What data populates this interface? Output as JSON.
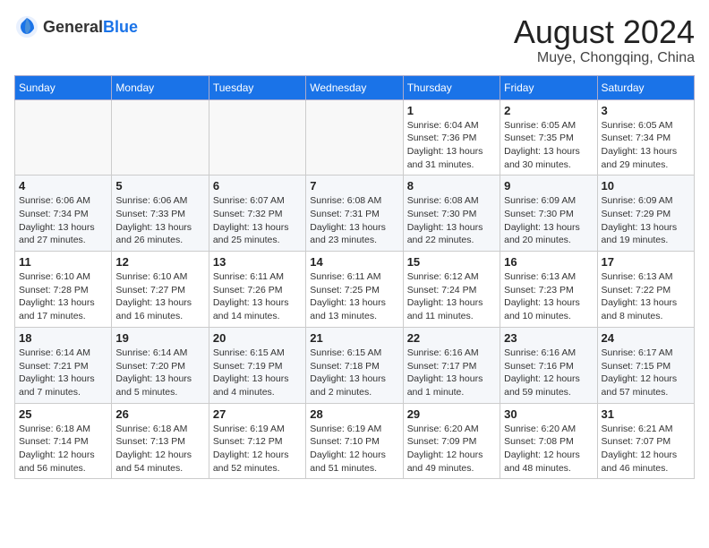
{
  "header": {
    "logo_general": "General",
    "logo_blue": "Blue",
    "month_title": "August 2024",
    "location": "Muye, Chongqing, China"
  },
  "weekdays": [
    "Sunday",
    "Monday",
    "Tuesday",
    "Wednesday",
    "Thursday",
    "Friday",
    "Saturday"
  ],
  "weeks": [
    [
      {
        "day": "",
        "info": ""
      },
      {
        "day": "",
        "info": ""
      },
      {
        "day": "",
        "info": ""
      },
      {
        "day": "",
        "info": ""
      },
      {
        "day": "1",
        "info": "Sunrise: 6:04 AM\nSunset: 7:36 PM\nDaylight: 13 hours\nand 31 minutes."
      },
      {
        "day": "2",
        "info": "Sunrise: 6:05 AM\nSunset: 7:35 PM\nDaylight: 13 hours\nand 30 minutes."
      },
      {
        "day": "3",
        "info": "Sunrise: 6:05 AM\nSunset: 7:34 PM\nDaylight: 13 hours\nand 29 minutes."
      }
    ],
    [
      {
        "day": "4",
        "info": "Sunrise: 6:06 AM\nSunset: 7:34 PM\nDaylight: 13 hours\nand 27 minutes."
      },
      {
        "day": "5",
        "info": "Sunrise: 6:06 AM\nSunset: 7:33 PM\nDaylight: 13 hours\nand 26 minutes."
      },
      {
        "day": "6",
        "info": "Sunrise: 6:07 AM\nSunset: 7:32 PM\nDaylight: 13 hours\nand 25 minutes."
      },
      {
        "day": "7",
        "info": "Sunrise: 6:08 AM\nSunset: 7:31 PM\nDaylight: 13 hours\nand 23 minutes."
      },
      {
        "day": "8",
        "info": "Sunrise: 6:08 AM\nSunset: 7:30 PM\nDaylight: 13 hours\nand 22 minutes."
      },
      {
        "day": "9",
        "info": "Sunrise: 6:09 AM\nSunset: 7:30 PM\nDaylight: 13 hours\nand 20 minutes."
      },
      {
        "day": "10",
        "info": "Sunrise: 6:09 AM\nSunset: 7:29 PM\nDaylight: 13 hours\nand 19 minutes."
      }
    ],
    [
      {
        "day": "11",
        "info": "Sunrise: 6:10 AM\nSunset: 7:28 PM\nDaylight: 13 hours\nand 17 minutes."
      },
      {
        "day": "12",
        "info": "Sunrise: 6:10 AM\nSunset: 7:27 PM\nDaylight: 13 hours\nand 16 minutes."
      },
      {
        "day": "13",
        "info": "Sunrise: 6:11 AM\nSunset: 7:26 PM\nDaylight: 13 hours\nand 14 minutes."
      },
      {
        "day": "14",
        "info": "Sunrise: 6:11 AM\nSunset: 7:25 PM\nDaylight: 13 hours\nand 13 minutes."
      },
      {
        "day": "15",
        "info": "Sunrise: 6:12 AM\nSunset: 7:24 PM\nDaylight: 13 hours\nand 11 minutes."
      },
      {
        "day": "16",
        "info": "Sunrise: 6:13 AM\nSunset: 7:23 PM\nDaylight: 13 hours\nand 10 minutes."
      },
      {
        "day": "17",
        "info": "Sunrise: 6:13 AM\nSunset: 7:22 PM\nDaylight: 13 hours\nand 8 minutes."
      }
    ],
    [
      {
        "day": "18",
        "info": "Sunrise: 6:14 AM\nSunset: 7:21 PM\nDaylight: 13 hours\nand 7 minutes."
      },
      {
        "day": "19",
        "info": "Sunrise: 6:14 AM\nSunset: 7:20 PM\nDaylight: 13 hours\nand 5 minutes."
      },
      {
        "day": "20",
        "info": "Sunrise: 6:15 AM\nSunset: 7:19 PM\nDaylight: 13 hours\nand 4 minutes."
      },
      {
        "day": "21",
        "info": "Sunrise: 6:15 AM\nSunset: 7:18 PM\nDaylight: 13 hours\nand 2 minutes."
      },
      {
        "day": "22",
        "info": "Sunrise: 6:16 AM\nSunset: 7:17 PM\nDaylight: 13 hours\nand 1 minute."
      },
      {
        "day": "23",
        "info": "Sunrise: 6:16 AM\nSunset: 7:16 PM\nDaylight: 12 hours\nand 59 minutes."
      },
      {
        "day": "24",
        "info": "Sunrise: 6:17 AM\nSunset: 7:15 PM\nDaylight: 12 hours\nand 57 minutes."
      }
    ],
    [
      {
        "day": "25",
        "info": "Sunrise: 6:18 AM\nSunset: 7:14 PM\nDaylight: 12 hours\nand 56 minutes."
      },
      {
        "day": "26",
        "info": "Sunrise: 6:18 AM\nSunset: 7:13 PM\nDaylight: 12 hours\nand 54 minutes."
      },
      {
        "day": "27",
        "info": "Sunrise: 6:19 AM\nSunset: 7:12 PM\nDaylight: 12 hours\nand 52 minutes."
      },
      {
        "day": "28",
        "info": "Sunrise: 6:19 AM\nSunset: 7:10 PM\nDaylight: 12 hours\nand 51 minutes."
      },
      {
        "day": "29",
        "info": "Sunrise: 6:20 AM\nSunset: 7:09 PM\nDaylight: 12 hours\nand 49 minutes."
      },
      {
        "day": "30",
        "info": "Sunrise: 6:20 AM\nSunset: 7:08 PM\nDaylight: 12 hours\nand 48 minutes."
      },
      {
        "day": "31",
        "info": "Sunrise: 6:21 AM\nSunset: 7:07 PM\nDaylight: 12 hours\nand 46 minutes."
      }
    ]
  ]
}
